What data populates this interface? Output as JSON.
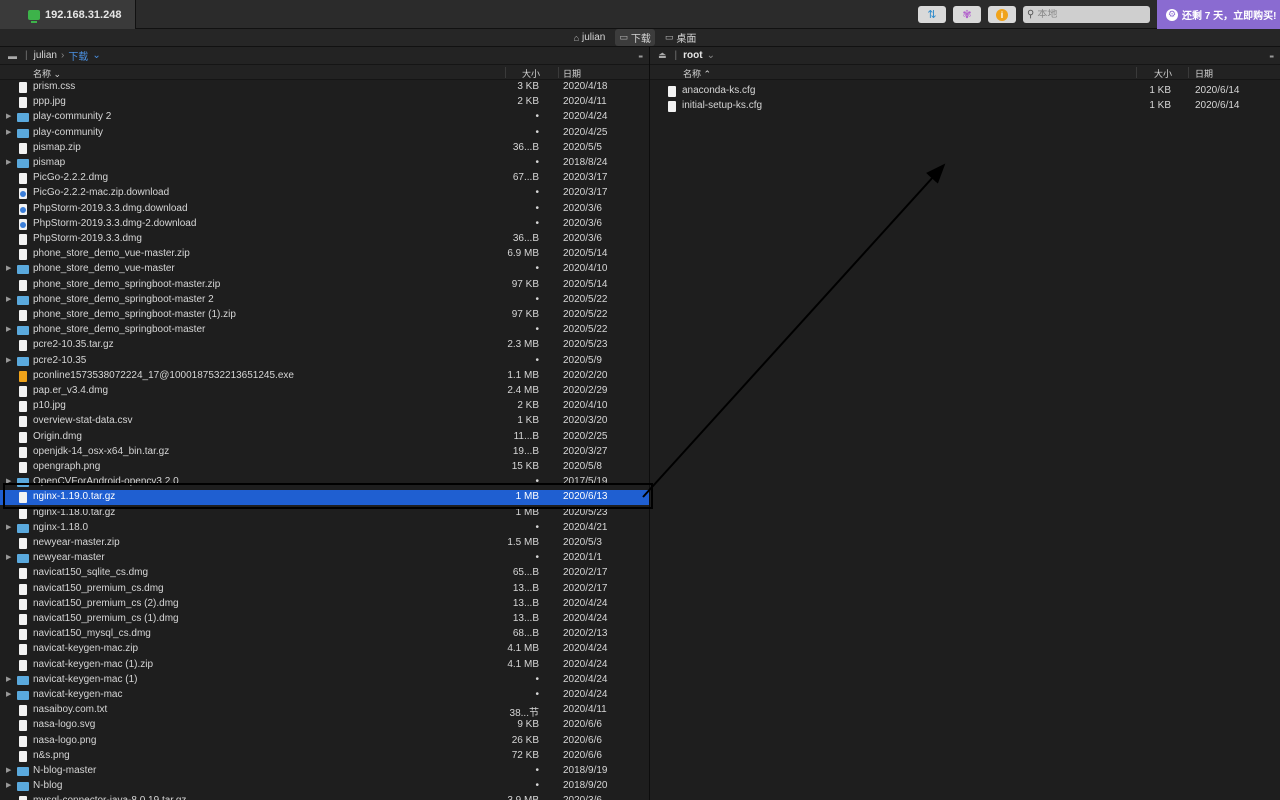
{
  "titlebar": {
    "host": "192.168.31.248",
    "search_placeholder": "本地",
    "buy_label": "还剩 7 天，立即购买!"
  },
  "favorites": [
    {
      "label": "julian",
      "icon": "home-icon"
    },
    {
      "label": "下载",
      "icon": "folder-icon",
      "active": true
    },
    {
      "label": "桌面",
      "icon": "desktop-icon"
    }
  ],
  "left": {
    "path": [
      "julian",
      "下载"
    ],
    "columns": {
      "name": "名称",
      "size": "大小",
      "date": "日期"
    },
    "rows": [
      {
        "name": "prism.css",
        "size": "3 KB",
        "date": "2020/4/18",
        "kind": "file"
      },
      {
        "name": "ppp.jpg",
        "size": "2 KB",
        "date": "2020/4/11",
        "kind": "file"
      },
      {
        "name": "play-community 2",
        "size": "•",
        "date": "2020/4/24",
        "kind": "folder"
      },
      {
        "name": "play-community",
        "size": "•",
        "date": "2020/4/25",
        "kind": "folder"
      },
      {
        "name": "pismap.zip",
        "size": "36...B",
        "date": "2020/5/5",
        "kind": "file"
      },
      {
        "name": "pismap",
        "size": "•",
        "date": "2018/8/24",
        "kind": "folder"
      },
      {
        "name": "PicGo-2.2.2.dmg",
        "size": "67...B",
        "date": "2020/3/17",
        "kind": "file"
      },
      {
        "name": "PicGo-2.2.2-mac.zip.download",
        "size": "•",
        "date": "2020/3/17",
        "kind": "download"
      },
      {
        "name": "PhpStorm-2019.3.3.dmg.download",
        "size": "•",
        "date": "2020/3/6",
        "kind": "download"
      },
      {
        "name": "PhpStorm-2019.3.3.dmg-2.download",
        "size": "•",
        "date": "2020/3/6",
        "kind": "download"
      },
      {
        "name": "PhpStorm-2019.3.3.dmg",
        "size": "36...B",
        "date": "2020/3/6",
        "kind": "file"
      },
      {
        "name": "phone_store_demo_vue-master.zip",
        "size": "6.9 MB",
        "date": "2020/5/14",
        "kind": "file"
      },
      {
        "name": "phone_store_demo_vue-master",
        "size": "•",
        "date": "2020/4/10",
        "kind": "folder"
      },
      {
        "name": "phone_store_demo_springboot-master.zip",
        "size": "97 KB",
        "date": "2020/5/14",
        "kind": "file"
      },
      {
        "name": "phone_store_demo_springboot-master 2",
        "size": "•",
        "date": "2020/5/22",
        "kind": "folder"
      },
      {
        "name": "phone_store_demo_springboot-master (1).zip",
        "size": "97 KB",
        "date": "2020/5/22",
        "kind": "file"
      },
      {
        "name": "phone_store_demo_springboot-master",
        "size": "•",
        "date": "2020/5/22",
        "kind": "folder"
      },
      {
        "name": "pcre2-10.35.tar.gz",
        "size": "2.3 MB",
        "date": "2020/5/23",
        "kind": "file"
      },
      {
        "name": "pcre2-10.35",
        "size": "•",
        "date": "2020/5/9",
        "kind": "folder"
      },
      {
        "name": "pconline1573538072224_17@1000187532213651245.exe",
        "size": "1.1 MB",
        "date": "2020/2/20",
        "kind": "exe"
      },
      {
        "name": "pap.er_v3.4.dmg",
        "size": "2.4 MB",
        "date": "2020/2/29",
        "kind": "file"
      },
      {
        "name": "p10.jpg",
        "size": "2 KB",
        "date": "2020/4/10",
        "kind": "file"
      },
      {
        "name": "overview-stat-data.csv",
        "size": "1 KB",
        "date": "2020/3/20",
        "kind": "file"
      },
      {
        "name": "Origin.dmg",
        "size": "11...B",
        "date": "2020/2/25",
        "kind": "file"
      },
      {
        "name": "openjdk-14_osx-x64_bin.tar.gz",
        "size": "19...B",
        "date": "2020/3/27",
        "kind": "file"
      },
      {
        "name": "opengraph.png",
        "size": "15 KB",
        "date": "2020/5/8",
        "kind": "file"
      },
      {
        "name": "OpenCVForAndroid-opencv3.2.0",
        "size": "•",
        "date": "2017/5/19",
        "kind": "folder"
      },
      {
        "name": "nginx-1.19.0.tar.gz",
        "size": "1 MB",
        "date": "2020/6/13",
        "kind": "file",
        "selected": true
      },
      {
        "name": "nginx-1.18.0.tar.gz",
        "size": "1 MB",
        "date": "2020/5/23",
        "kind": "file"
      },
      {
        "name": "nginx-1.18.0",
        "size": "•",
        "date": "2020/4/21",
        "kind": "folder"
      },
      {
        "name": "newyear-master.zip",
        "size": "1.5 MB",
        "date": "2020/5/3",
        "kind": "file"
      },
      {
        "name": "newyear-master",
        "size": "•",
        "date": "2020/1/1",
        "kind": "folder"
      },
      {
        "name": "navicat150_sqlite_cs.dmg",
        "size": "65...B",
        "date": "2020/2/17",
        "kind": "file"
      },
      {
        "name": "navicat150_premium_cs.dmg",
        "size": "13...B",
        "date": "2020/2/17",
        "kind": "file"
      },
      {
        "name": "navicat150_premium_cs (2).dmg",
        "size": "13...B",
        "date": "2020/4/24",
        "kind": "file"
      },
      {
        "name": "navicat150_premium_cs (1).dmg",
        "size": "13...B",
        "date": "2020/4/24",
        "kind": "file"
      },
      {
        "name": "navicat150_mysql_cs.dmg",
        "size": "68...B",
        "date": "2020/2/13",
        "kind": "file"
      },
      {
        "name": "navicat-keygen-mac.zip",
        "size": "4.1 MB",
        "date": "2020/4/24",
        "kind": "file"
      },
      {
        "name": "navicat-keygen-mac (1).zip",
        "size": "4.1 MB",
        "date": "2020/4/24",
        "kind": "file"
      },
      {
        "name": "navicat-keygen-mac (1)",
        "size": "•",
        "date": "2020/4/24",
        "kind": "folder"
      },
      {
        "name": "navicat-keygen-mac",
        "size": "•",
        "date": "2020/4/24",
        "kind": "folder"
      },
      {
        "name": "nasaiboy.com.txt",
        "size": "38...节",
        "date": "2020/4/11",
        "kind": "file"
      },
      {
        "name": "nasa-logo.svg",
        "size": "9 KB",
        "date": "2020/6/6",
        "kind": "file"
      },
      {
        "name": "nasa-logo.png",
        "size": "26 KB",
        "date": "2020/6/6",
        "kind": "file"
      },
      {
        "name": "n&s.png",
        "size": "72 KB",
        "date": "2020/6/6",
        "kind": "file"
      },
      {
        "name": "N-blog-master",
        "size": "•",
        "date": "2018/9/19",
        "kind": "folder"
      },
      {
        "name": "N-blog",
        "size": "•",
        "date": "2018/9/20",
        "kind": "folder"
      },
      {
        "name": "mysql-connector-java-8.0.19.tar.gz",
        "size": "3.9 MB",
        "date": "2020/3/6",
        "kind": "file"
      }
    ]
  },
  "right": {
    "path": [
      "root"
    ],
    "columns": {
      "name": "名称",
      "size": "大小",
      "date": "日期"
    },
    "rows": [
      {
        "name": "anaconda-ks.cfg",
        "size": "1 KB",
        "date": "2020/6/14",
        "kind": "file"
      },
      {
        "name": "initial-setup-ks.cfg",
        "size": "1 KB",
        "date": "2020/6/14",
        "kind": "file"
      }
    ]
  }
}
